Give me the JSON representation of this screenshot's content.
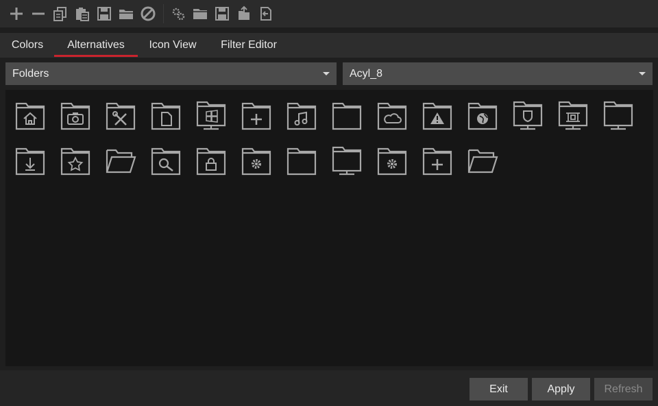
{
  "toolbar": {
    "icons": [
      "add-icon",
      "remove-icon",
      "copy-icon",
      "paste-icon",
      "save-icon",
      "open-folder-icon",
      "disable-icon",
      "settings-icon",
      "folder-icon",
      "save-alt-icon",
      "export-icon",
      "import-icon"
    ]
  },
  "tabs": [
    {
      "label": "Colors",
      "active": false
    },
    {
      "label": "Alternatives",
      "active": true
    },
    {
      "label": "Icon View",
      "active": false
    },
    {
      "label": "Filter Editor",
      "active": false
    }
  ],
  "category_select": {
    "value": "Folders"
  },
  "theme_select": {
    "value": "Acyl_8"
  },
  "icons": [
    "folder-home-icon",
    "folder-camera-icon",
    "folder-tools-icon",
    "folder-document-icon",
    "folder-windows-icon",
    "folder-add-icon",
    "folder-music-icon",
    "folder-plain-icon",
    "folder-cloud-icon",
    "folder-warning-icon",
    "folder-globe-icon",
    "folder-shield-icon",
    "folder-pictures-icon",
    "folder-monitor-icon",
    "folder-download-icon",
    "folder-star-icon",
    "folder-open-icon",
    "folder-search-icon",
    "folder-lock-icon",
    "folder-settings-icon",
    "folder-plain-2-icon",
    "folder-network-icon",
    "folder-settings-2-icon",
    "folder-add-2-icon",
    "folder-open-2-icon"
  ],
  "buttons": {
    "exit": "Exit",
    "apply": "Apply",
    "refresh": "Refresh"
  },
  "colors": {
    "accent": "#c9232d",
    "icon": "#a8a8a8"
  }
}
